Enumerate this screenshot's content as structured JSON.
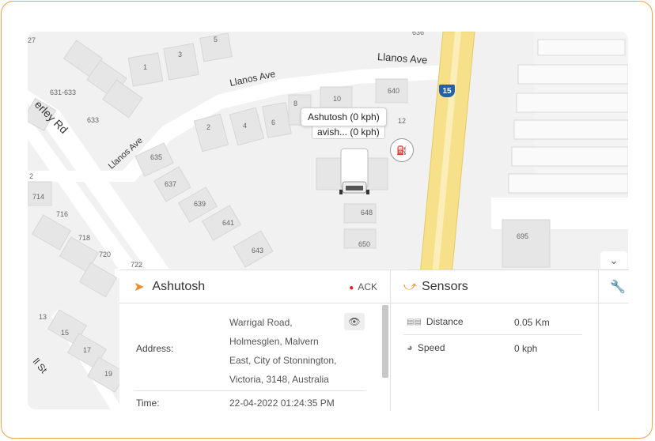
{
  "map": {
    "streets": [
      "Llanos Ave",
      "Llanos Ave",
      "Llanos Ave",
      "erley Rd",
      "ll St"
    ],
    "route_shield": "15",
    "house_numbers": [
      "27",
      "5",
      "3",
      "1",
      "631-633",
      "633",
      "635",
      "637",
      "639",
      "641",
      "643",
      "2",
      "4",
      "6",
      "8",
      "10",
      "640",
      "12",
      "648",
      "650",
      "636",
      "714",
      "716",
      "718",
      "720",
      "722",
      "13",
      "15",
      "17",
      "19",
      "695",
      "2"
    ]
  },
  "vehicle": {
    "tooltip": "Ashutosh (0 kph)",
    "tooltip_back": "avish... (0 kph)",
    "poi_icon": "fuel-station-icon"
  },
  "panel": {
    "vehicle_name": "Ashutosh",
    "ack_label": "ACK",
    "address_label": "Address:",
    "address_lines": [
      "Warrigal Road,",
      "Holmesglen, Malvern",
      "East, City of Stonnington,",
      "Victoria, 3148, Australia"
    ],
    "time_label": "Time:",
    "time_value": "22-04-2022 01:24:35 PM",
    "sensors_title": "Sensors",
    "sensors": [
      {
        "name": "Distance",
        "value": "0.05 Km",
        "icon": "odometer-icon"
      },
      {
        "name": "Speed",
        "value": "0 kph",
        "icon": "speedometer-icon"
      }
    ]
  },
  "colors": {
    "accent": "#f08a24",
    "ack_dot": "#e02020",
    "highway": "#f7e08a",
    "frame": "#f0a050"
  }
}
